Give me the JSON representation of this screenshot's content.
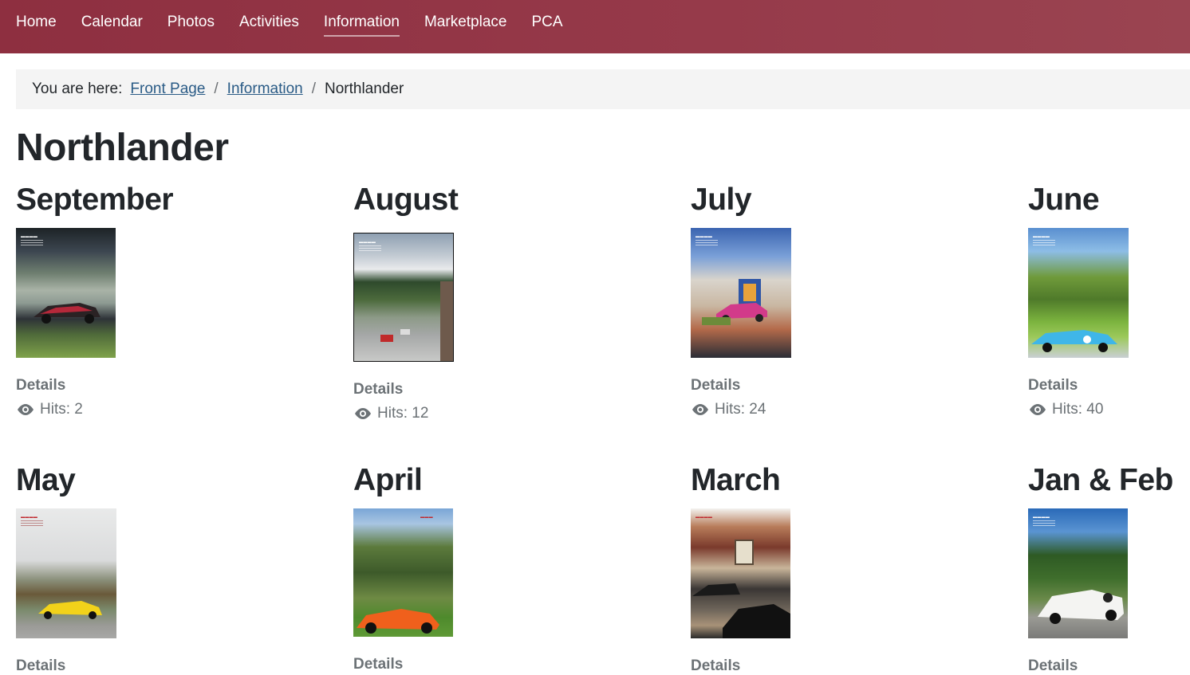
{
  "nav": {
    "items": [
      {
        "label": "Home"
      },
      {
        "label": "Calendar"
      },
      {
        "label": "Photos"
      },
      {
        "label": "Activities"
      },
      {
        "label": "Information",
        "active": true
      },
      {
        "label": "Marketplace"
      },
      {
        "label": "PCA"
      }
    ]
  },
  "breadcrumb": {
    "lead": "You are here:",
    "links": [
      "Front Page",
      "Information"
    ],
    "separator": "/",
    "current": "Northlander"
  },
  "page": {
    "title": "Northlander"
  },
  "issues": [
    {
      "month": "September",
      "details": "Details",
      "hits": "Hits: 2"
    },
    {
      "month": "August",
      "details": "Details",
      "hits": "Hits: 12"
    },
    {
      "month": "July",
      "details": "Details",
      "hits": "Hits: 24"
    },
    {
      "month": "June",
      "details": "Details",
      "hits": "Hits: 40"
    },
    {
      "month": "May",
      "details": "Details"
    },
    {
      "month": "April",
      "details": "Details"
    },
    {
      "month": "March",
      "details": "Details"
    },
    {
      "month": "Jan & Feb",
      "details": "Details"
    }
  ],
  "icons": {
    "hits": "eye-icon"
  },
  "colors": {
    "nav_bg": "#8e2f40",
    "link": "#2a5b86",
    "muted": "#6c7276"
  }
}
